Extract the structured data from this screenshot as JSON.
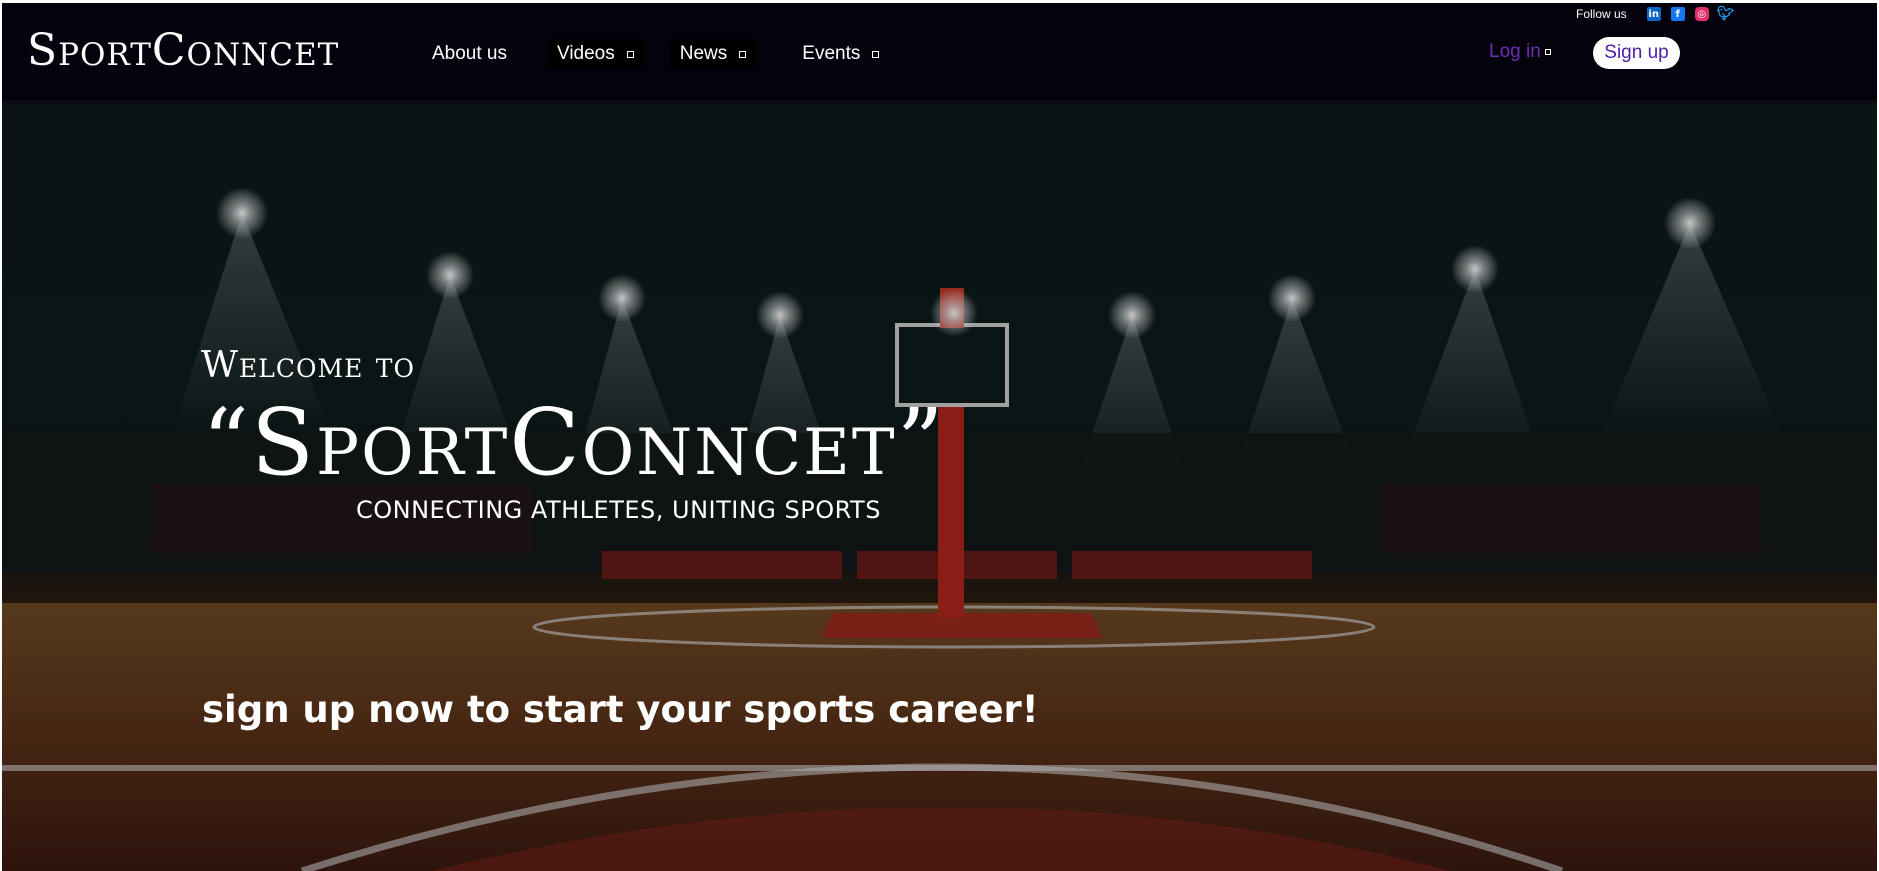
{
  "header": {
    "logo": "SportConncet",
    "nav": [
      {
        "label": "About us"
      },
      {
        "label": "Videos"
      },
      {
        "label": "News"
      },
      {
        "label": "Events"
      }
    ],
    "follow_label": "Follow us",
    "social": [
      "linkedin-icon",
      "facebook-icon",
      "instagram-icon",
      "twitter-icon"
    ],
    "login_label": "Log in",
    "signup_label": "Sign up"
  },
  "hero": {
    "welcome": "Welcome to",
    "title": "“SportConncet”",
    "tagline": "CONNECTING ATHLETES, UNITING SPORTS",
    "cta": "sign up now to start your sports career!"
  },
  "colors": {
    "header_bg": "#04030d",
    "login_text": "#6b2fb6",
    "signup_text": "#4b1ea8"
  }
}
